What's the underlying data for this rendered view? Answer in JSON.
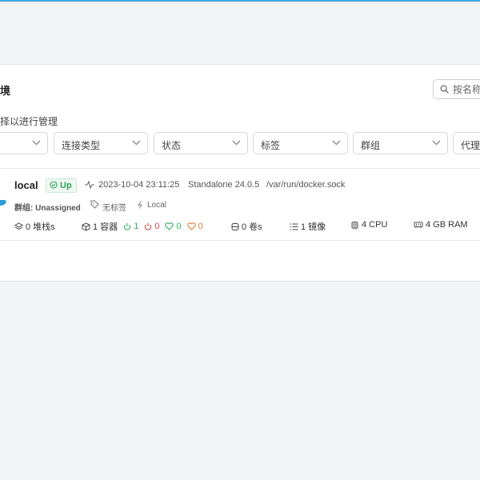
{
  "panel": {
    "title": "境",
    "subtitle": "择以进行管理",
    "search_placeholder": "按名称"
  },
  "filters": [
    {
      "label": ""
    },
    {
      "label": "连接类型"
    },
    {
      "label": "状态"
    },
    {
      "label": "标签"
    },
    {
      "label": "群组"
    },
    {
      "label": "代理"
    }
  ],
  "environment": {
    "name": "local",
    "status": "Up",
    "timestamp": "2023-10-04 23:11:25",
    "engine": "Standalone 24.0.5",
    "socket": "/var/run/docker.sock",
    "group": "群组: Unassigned",
    "tags": "无标签",
    "type": "Local",
    "stats": {
      "stacks": "0 堆栈s",
      "containers": "1 容器",
      "running": "1",
      "stopped": "0",
      "healthy": "0",
      "unhealthy": "0",
      "volumes": "0 卷s",
      "images": "1 镜像",
      "cpu": "4 CPU",
      "ram": "4 GB RAM"
    }
  },
  "colors": {
    "accent": "#3ea6e3",
    "up_green": "#2e9f58",
    "stopped_red": "#d34a4a",
    "unhealthy_orange": "#e07b2e"
  },
  "icons": [
    "search-icon",
    "chevron-down-icon",
    "check-circle-icon",
    "heartbeat-icon",
    "tag-icon",
    "bolt-icon",
    "layers-icon",
    "cube-icon",
    "power-icon",
    "heart-icon",
    "database-icon",
    "list-icon",
    "cpu-icon",
    "memory-icon",
    "docker-logo-icon"
  ]
}
